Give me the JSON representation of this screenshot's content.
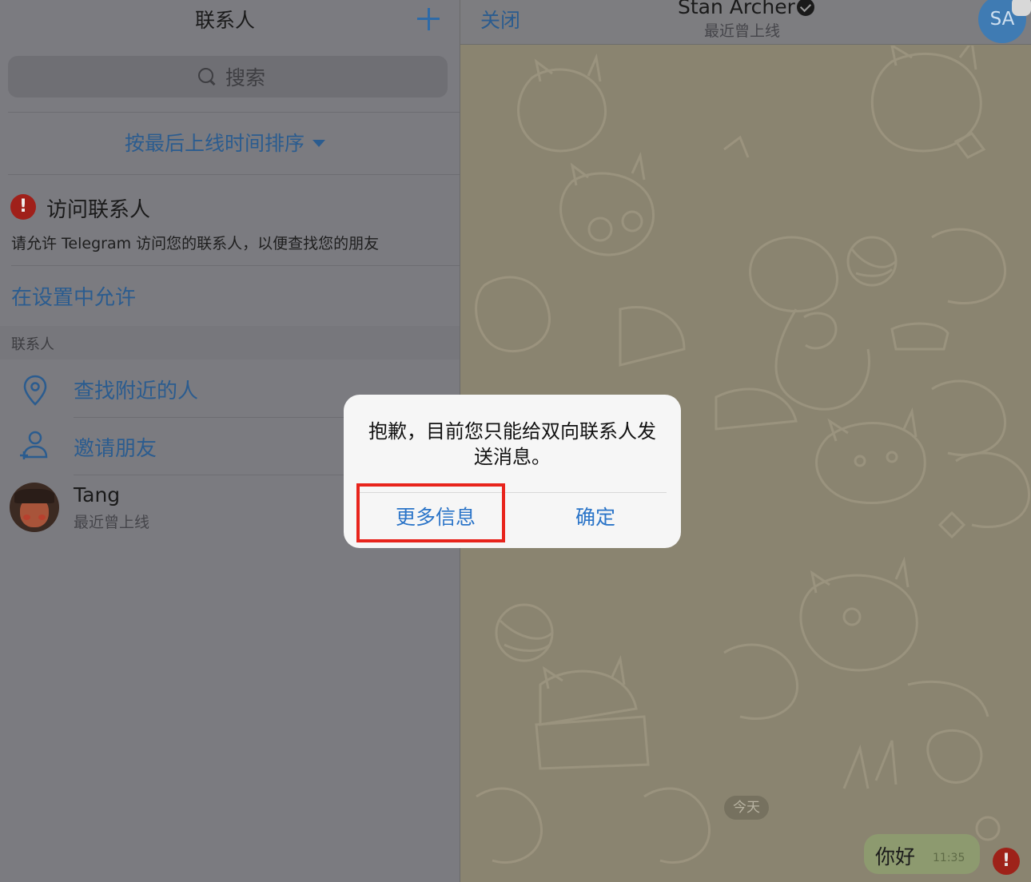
{
  "contacts_pane": {
    "title": "联系人",
    "search_placeholder": "搜索",
    "sort_label": "按最后上线时间排序",
    "permission": {
      "title": "访问联系人",
      "description": "请允许 Telegram 访问您的联系人，以便查找您的朋友",
      "link": "在设置中允许"
    },
    "section_header": "联系人",
    "actions": [
      {
        "label": "查找附近的人",
        "icon": "location-pin-icon"
      },
      {
        "label": "邀请朋友",
        "icon": "add-person-icon"
      }
    ],
    "contacts": [
      {
        "name": "Tang",
        "status": "最近曾上线"
      }
    ]
  },
  "chat_pane": {
    "close_label": "关闭",
    "contact_name": "Stan Archer",
    "contact_status": "最近曾上线",
    "avatar_initials": "SA",
    "date_label": "今天",
    "messages": [
      {
        "text": "你好",
        "time": "11:35",
        "failed": true
      }
    ]
  },
  "alert": {
    "message": "抱歉，目前您只能给双向联系人发送消息。",
    "buttons": {
      "more_info": "更多信息",
      "ok": "确定"
    }
  },
  "colors": {
    "accent": "#2a74c8",
    "highlight": "#e8241c",
    "error": "#a0201a"
  }
}
